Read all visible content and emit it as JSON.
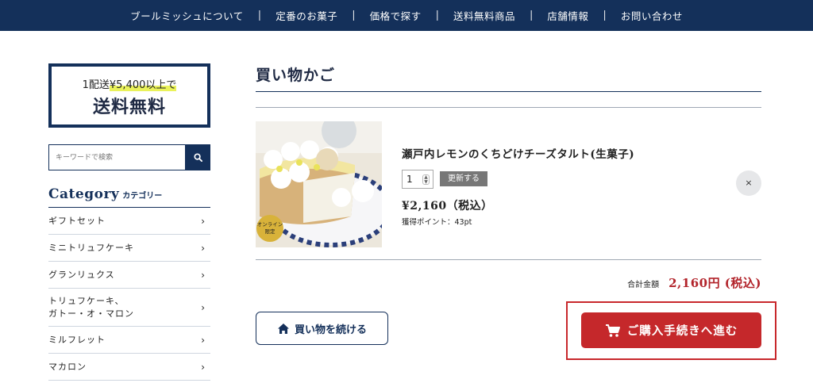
{
  "nav": {
    "items": [
      "ブールミッシュについて",
      "定番のお菓子",
      "価格で探す",
      "送料無料商品",
      "店舗情報",
      "お問い合わせ"
    ],
    "separator": "|"
  },
  "sidebar": {
    "banner": {
      "line1_prefix": "1配送",
      "line1_highlight": "¥5,400以上で",
      "line2": "送料無料"
    },
    "search": {
      "placeholder": "キーワードで検索",
      "icon": "search-icon"
    },
    "category": {
      "title_en": "Category",
      "title_ja": "カテゴリー",
      "items": [
        {
          "label": "ギフトセット"
        },
        {
          "label": "ミニトリュフケーキ"
        },
        {
          "label": "グランリュクス"
        },
        {
          "label": "トリュフケーキ、\nガトー・オ・マロン"
        },
        {
          "label": "ミルフレット"
        },
        {
          "label": "マカロン"
        }
      ],
      "chevron": "›"
    }
  },
  "main": {
    "page_title": "買い物かご",
    "cart_item": {
      "name": "瀬戸内レモンのくちどけチーズタルト(生菓子)",
      "quantity": "1",
      "update_label": "更新する",
      "price": "¥2,160（税込）",
      "points": "獲得ポイント：43pt",
      "badge_line1": "オンライン",
      "badge_line2": "限定",
      "remove_label": "×"
    },
    "total": {
      "label": "合計金額",
      "value": "2,160円 (税込)"
    },
    "continue_label": "買い物を続ける",
    "checkout_label": "ご購入手続きへ進む"
  },
  "colors": {
    "navy": "#14305a",
    "checkout_red": "#c5282b",
    "highlight_frame": "#c8282c",
    "total_red": "#b2232a",
    "banner_highlight": "#eaf25a"
  }
}
